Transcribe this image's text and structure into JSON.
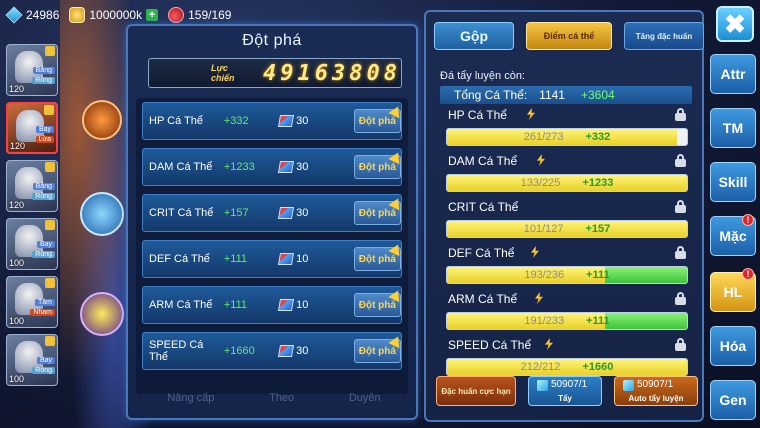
{
  "resources": {
    "gems": "24986",
    "gold": "1000000k",
    "stamina": "159/169"
  },
  "characters": [
    {
      "level": "120",
      "type1": "Bắng",
      "type2": "Rồng",
      "variant": "ice"
    },
    {
      "level": "120",
      "type1": "Bay",
      "type2": "Lửa",
      "variant": "fire",
      "selected": true
    },
    {
      "level": "120",
      "type1": "Bắng",
      "type2": "Rồng",
      "variant": "ice"
    },
    {
      "level": "100",
      "type1": "Bay",
      "type2": "Rồng",
      "variant": "ice"
    },
    {
      "level": "100",
      "type1": "Tâm",
      "type2": "Nham",
      "variant": "fire"
    },
    {
      "level": "100",
      "type1": "Bay",
      "type2": "Rồng",
      "variant": "ice"
    }
  ],
  "breakthrough": {
    "title": "Đột phá",
    "power_label": "Lực chiến",
    "power_value": "49163808",
    "button_label": "Đột phá",
    "rows": [
      {
        "name": "HP Cá Thể",
        "bonus": "+332",
        "cost": "30"
      },
      {
        "name": "DAM Cá Thể",
        "bonus": "+1233",
        "cost": "30"
      },
      {
        "name": "CRIT Cá Thể",
        "bonus": "+157",
        "cost": "30"
      },
      {
        "name": "DEF Cá Thể",
        "bonus": "+111",
        "cost": "10"
      },
      {
        "name": "ARM Cá Thể",
        "bonus": "+111",
        "cost": "10"
      },
      {
        "name": "SPEED Cá Thể",
        "bonus": "+1660",
        "cost": "30"
      }
    ],
    "ghost_tabs": [
      "Nâng cấp",
      "Theo",
      "Duyên"
    ]
  },
  "right_panel": {
    "tabs": {
      "gop": "Gộp",
      "diem": "Điểm cá thể",
      "tang": "Tăng đặc huấn"
    },
    "remain_label": "Đá tẩy luyện còn:",
    "total_label": "Tổng Cá Thể:",
    "total_value": "1141",
    "total_bonus": "+3604",
    "stats": [
      {
        "name": "HP Cá Thể",
        "current": "261/273",
        "bonus": "+332",
        "fill": 0.96,
        "green_fill": 0.0
      },
      {
        "name": "DAM Cá Thể",
        "current": "133/225",
        "bonus": "+1233",
        "fill": 1.0,
        "green_fill": 0.0
      },
      {
        "name": "CRIT Cá Thể",
        "current": "101/127",
        "bonus": "+157",
        "fill": 1.0,
        "green_fill": 0.0
      },
      {
        "name": "DEF Cá Thể",
        "current": "193/236",
        "bonus": "+111",
        "fill": 0.66,
        "green_fill": 0.34
      },
      {
        "name": "ARM Cá Thể",
        "current": "191/233",
        "bonus": "+111",
        "fill": 0.66,
        "green_fill": 0.34
      },
      {
        "name": "SPEED Cá Thể",
        "current": "212/212",
        "bonus": "+1660",
        "fill": 1.0,
        "green_fill": 0.0
      }
    ],
    "buttons": {
      "dac_huan": "Đặc huấn cực hạn",
      "tay_count": "50907/1",
      "tay_label": "Tẩy",
      "auto_count": "50907/1",
      "auto_label": "Auto tẩy luyện"
    }
  },
  "sidebar": {
    "close": "✖",
    "tabs": [
      "Attr",
      "TM",
      "Skill",
      "Mặc",
      "HL",
      "Hóa",
      "Gen"
    ],
    "active": "HL"
  }
}
